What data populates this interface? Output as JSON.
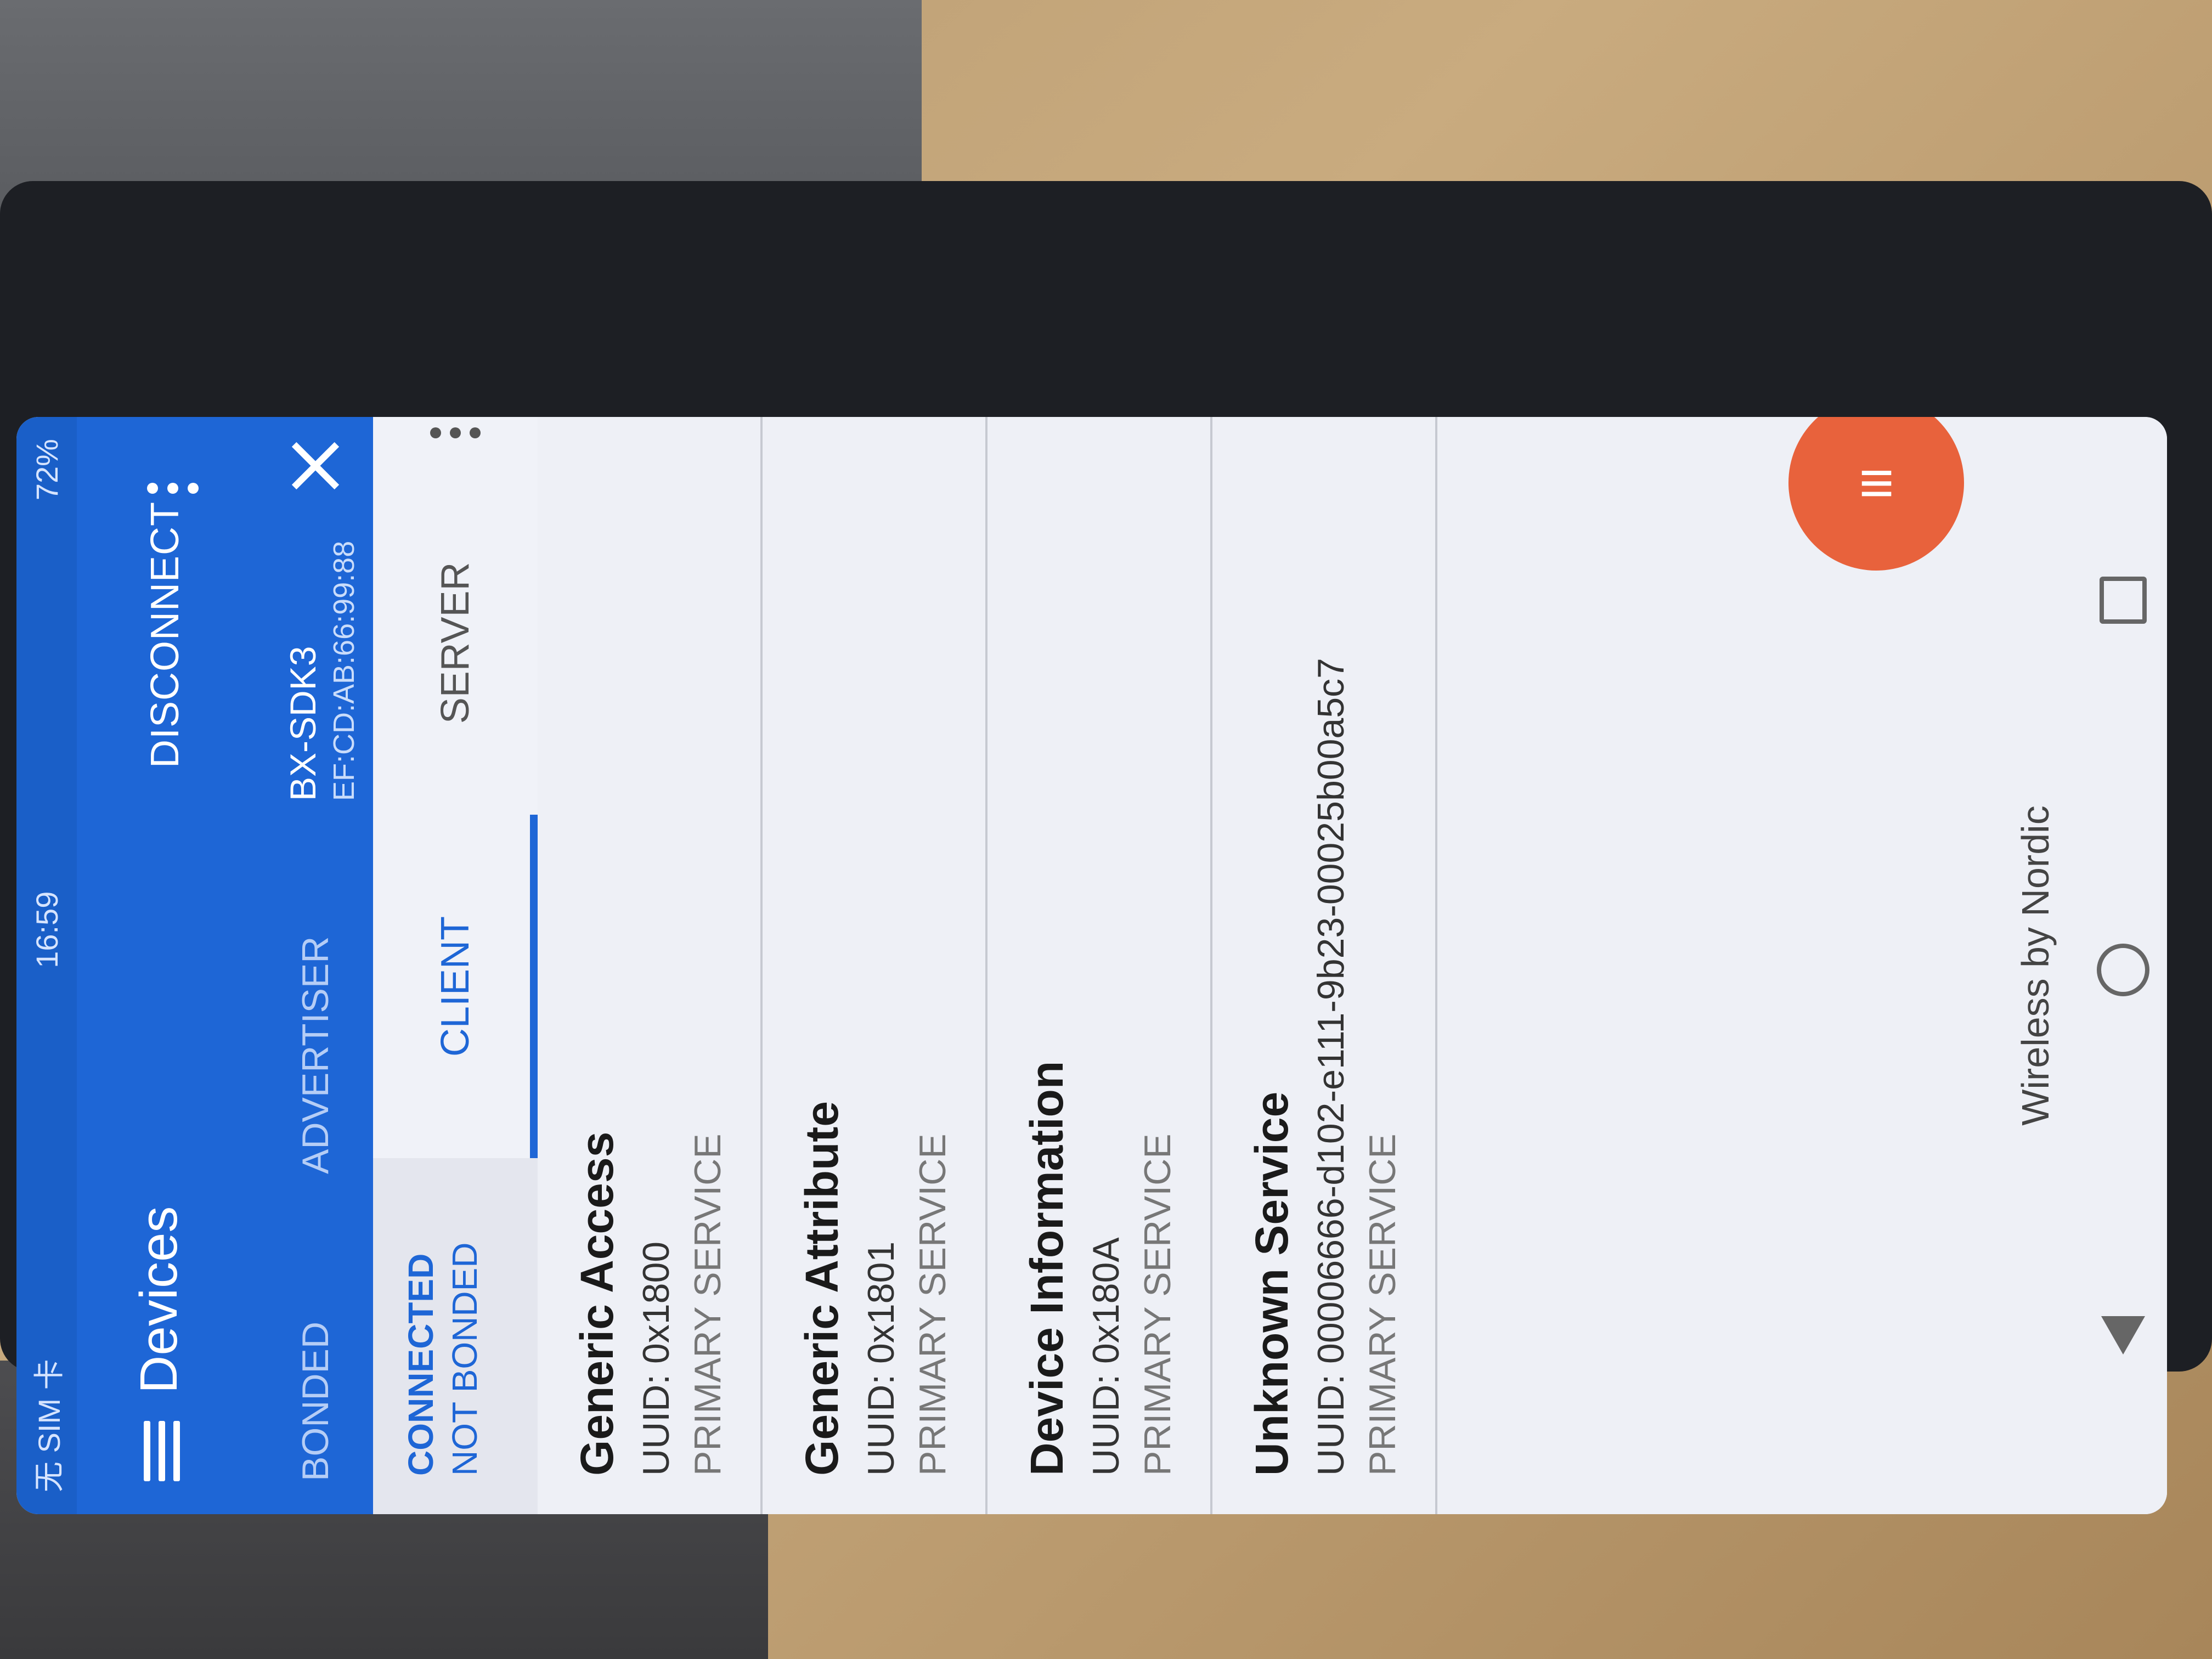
{
  "status_bar": {
    "carrier": "无 SIM 卡",
    "time": "16:59",
    "battery": "72%"
  },
  "app_bar": {
    "title": "Devices",
    "disconnect_label": "DISCONNECT"
  },
  "tabs": {
    "bonded": "BONDED",
    "advertiser": "ADVERTISER",
    "device_name": "BX-SDK3",
    "device_mac": "EF:CD:AB:66:99:88"
  },
  "connection": {
    "state": "CONNECTED",
    "bond_state": "NOT BONDED"
  },
  "sub_tabs": {
    "client": "CLIENT",
    "server": "SERVER"
  },
  "services": [
    {
      "name": "Generic Access",
      "uuid": "UUID: 0x1800",
      "type": "PRIMARY SERVICE"
    },
    {
      "name": "Generic Attribute",
      "uuid": "UUID: 0x1801",
      "type": "PRIMARY SERVICE"
    },
    {
      "name": "Device Information",
      "uuid": "UUID: 0x180A",
      "type": "PRIMARY SERVICE"
    },
    {
      "name": "Unknown Service",
      "uuid": "UUID: 00006666-d102-e111-9b23-00025b00a5c7",
      "type": "PRIMARY SERVICE"
    }
  ],
  "footer": {
    "branding": "Wireless by Nordic"
  },
  "colors": {
    "primary": "#1e66d6",
    "fab": "#e8623c"
  }
}
